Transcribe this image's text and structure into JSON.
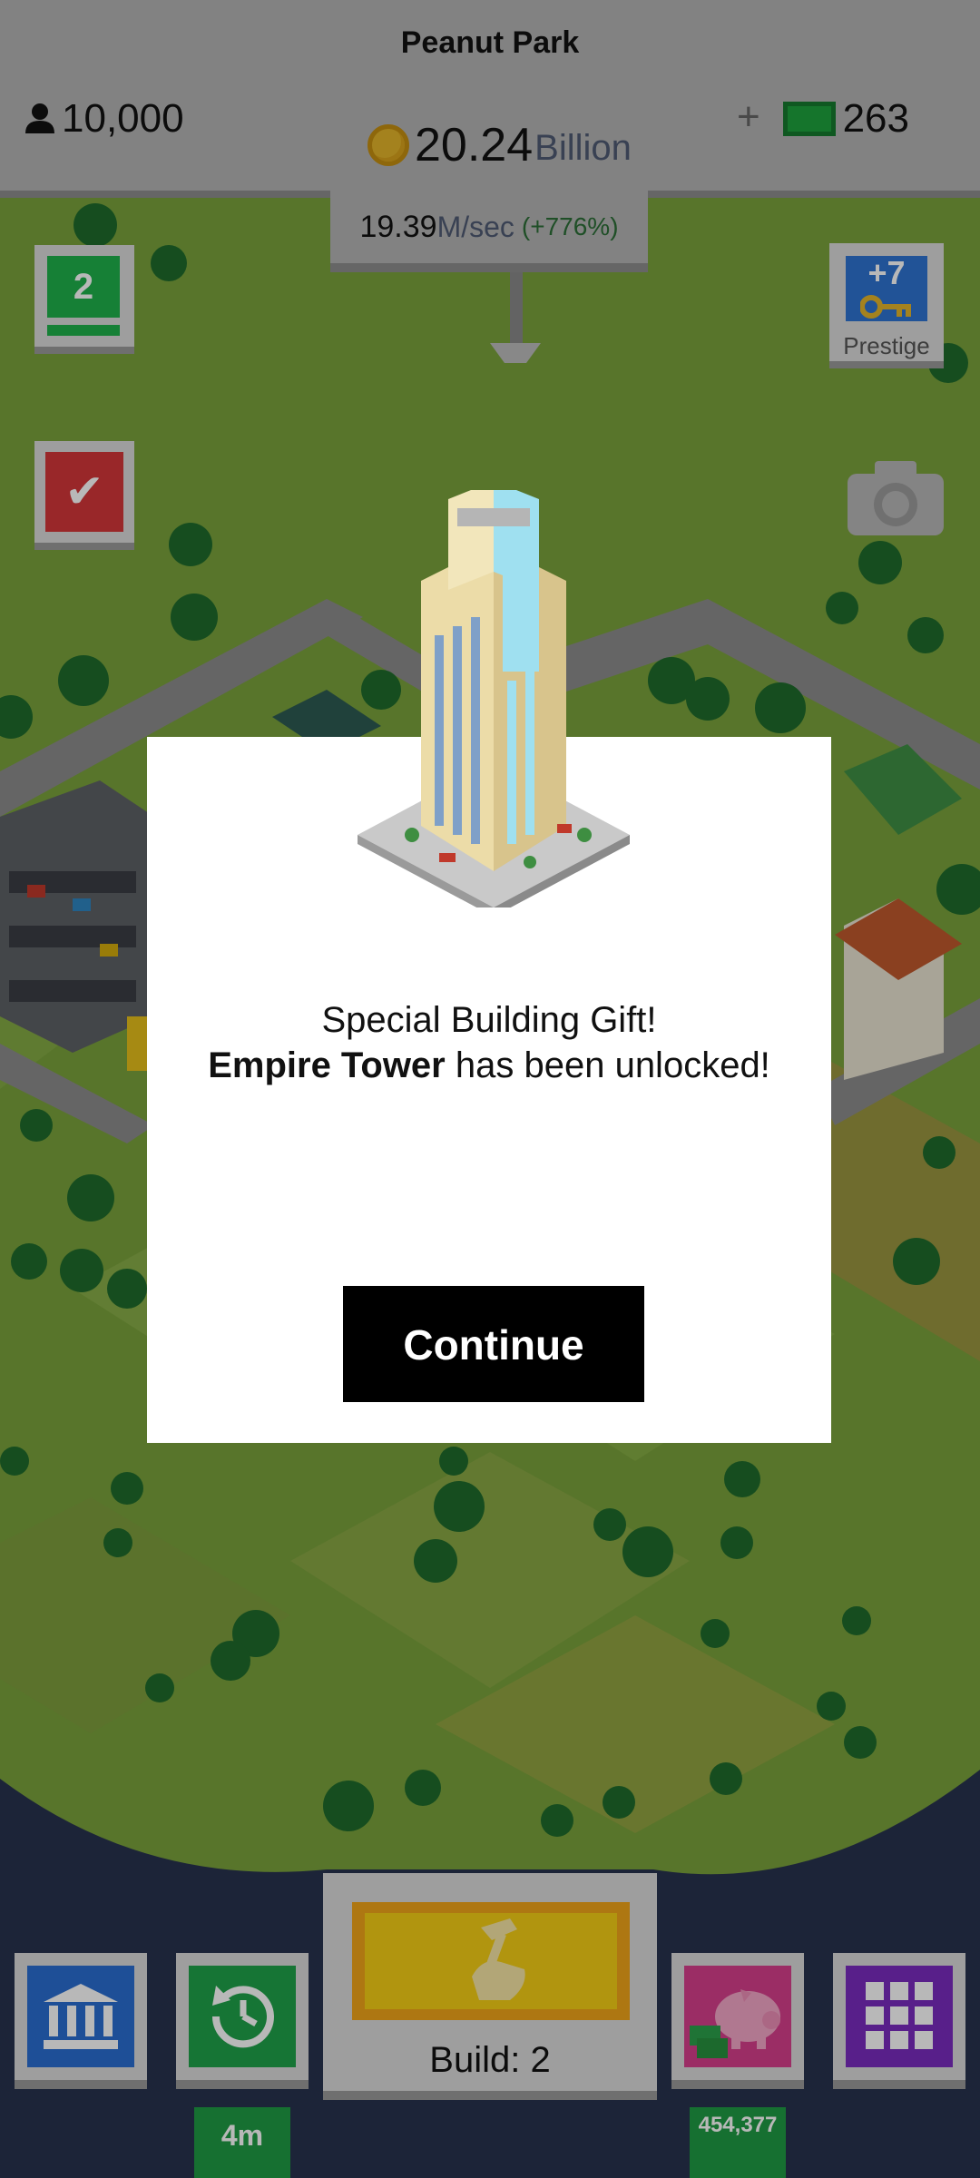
{
  "hud": {
    "park_name": "Peanut Park",
    "population": "10,000",
    "coins_value": "20.24",
    "coins_unit": "Billion",
    "cash_plus": "+",
    "cash": "263",
    "rate_value": "19.39",
    "rate_unit": "M/sec",
    "rate_percent": "(+776%)"
  },
  "side": {
    "level": "2",
    "task_icon": "✔",
    "prestige_bonus": "+7",
    "prestige_label": "Prestige"
  },
  "dialog": {
    "line1": "Special Building Gift!",
    "building_name": "Empire Tower",
    "line2_rest": " has been unlocked!",
    "continue_label": "Continue"
  },
  "bottom": {
    "build_label": "Build: 2",
    "time_label": "4m",
    "piggy_value": "454,377"
  },
  "colors": {
    "grass": "#79a03b",
    "hud": "#b4b4b4",
    "water": "#27324e",
    "build_yellow": "#f5cf15"
  }
}
